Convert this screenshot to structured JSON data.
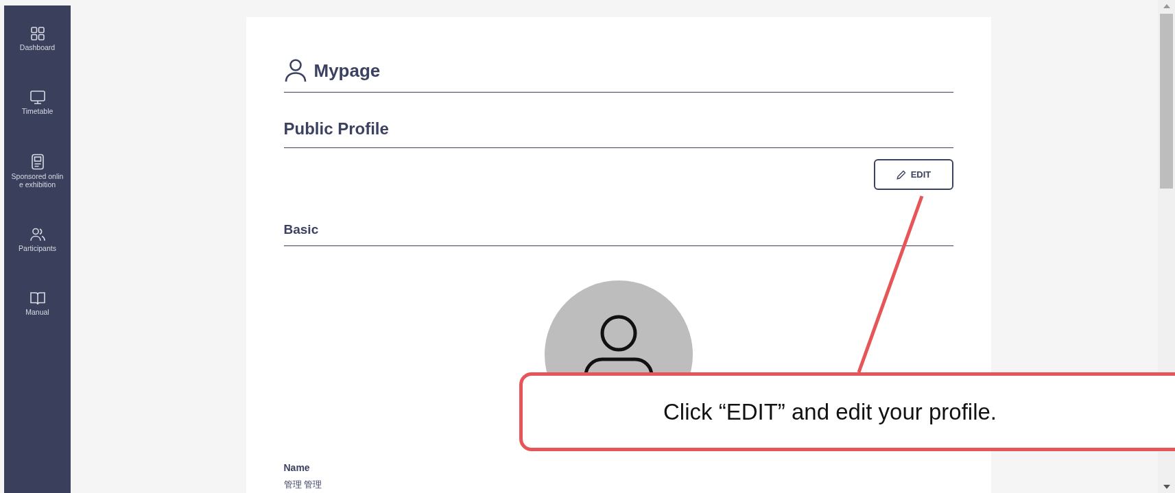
{
  "sidebar": {
    "items": [
      {
        "kind": "grid",
        "label": "Dashboard"
      },
      {
        "kind": "monitor",
        "label": "Timetable"
      },
      {
        "kind": "kiosk",
        "label": "Sponsored onlin\ne exhibition"
      },
      {
        "kind": "people",
        "label": "Participants"
      },
      {
        "kind": "book",
        "label": "Manual"
      }
    ]
  },
  "page": {
    "title": "Mypage",
    "section": "Public Profile",
    "edit_button": "EDIT",
    "subsection": "Basic",
    "fields": [
      {
        "label": "Name",
        "value": "管理 管理"
      }
    ]
  },
  "callout": {
    "text": "Click “EDIT” and edit your profile."
  }
}
